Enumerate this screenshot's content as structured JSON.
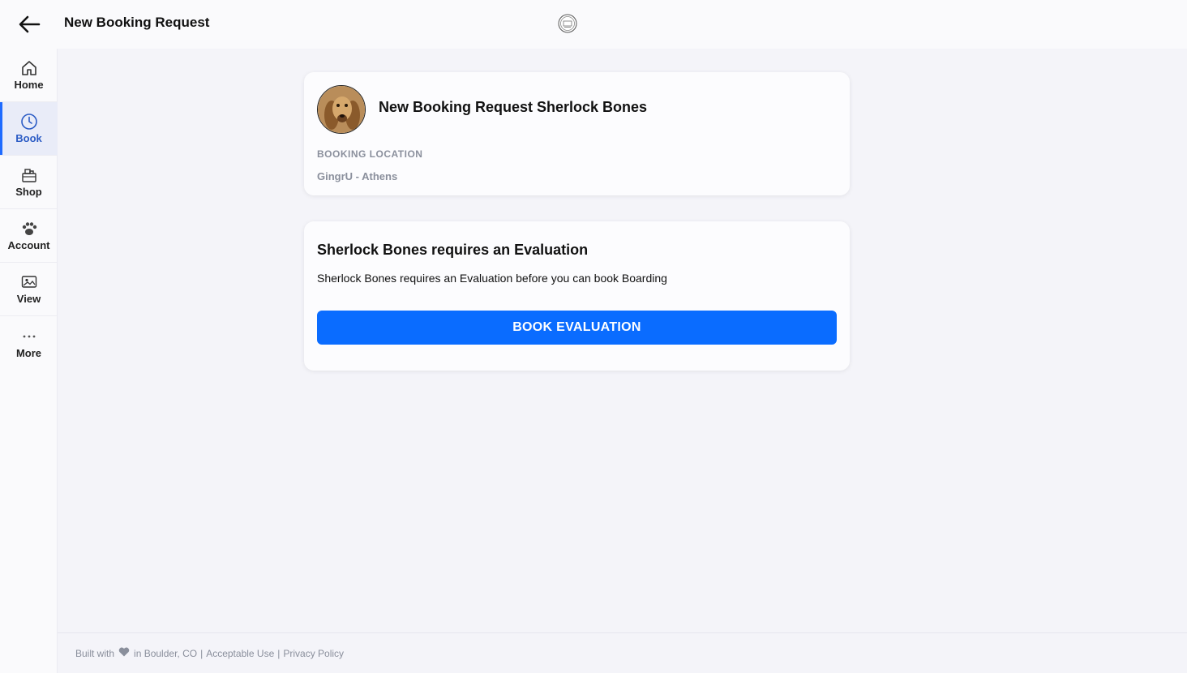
{
  "header": {
    "title": "New Booking Request",
    "back_icon": "arrow-left-icon",
    "logo_icon": "brand-logo-icon"
  },
  "sidebar": {
    "items": [
      {
        "label": "Home",
        "icon": "home-icon",
        "active": false
      },
      {
        "label": "Book",
        "icon": "clock-icon",
        "active": true
      },
      {
        "label": "Shop",
        "icon": "shop-icon",
        "active": false
      },
      {
        "label": "Account",
        "icon": "paw-icon",
        "active": false
      },
      {
        "label": "View",
        "icon": "image-icon",
        "active": false
      },
      {
        "label": "More",
        "icon": "more-icon",
        "active": false
      }
    ]
  },
  "booking_card": {
    "title": "New Booking Request Sherlock Bones",
    "location_label": "BOOKING LOCATION",
    "location_value": "GingrU - Athens"
  },
  "evaluation_card": {
    "title": "Sherlock Bones requires an Evaluation",
    "message": "Sherlock Bones requires an Evaluation before you can book Boarding",
    "button_label": "BOOK EVALUATION"
  },
  "footer": {
    "built_with": "Built with",
    "location": "in Boulder, CO",
    "separator": "|",
    "acceptable_use": "Acceptable Use",
    "privacy_policy": "Privacy Policy"
  },
  "colors": {
    "accent": "#0a6cff",
    "active_nav_bg": "#e9ecf8",
    "muted_text": "#8a8f9c"
  }
}
